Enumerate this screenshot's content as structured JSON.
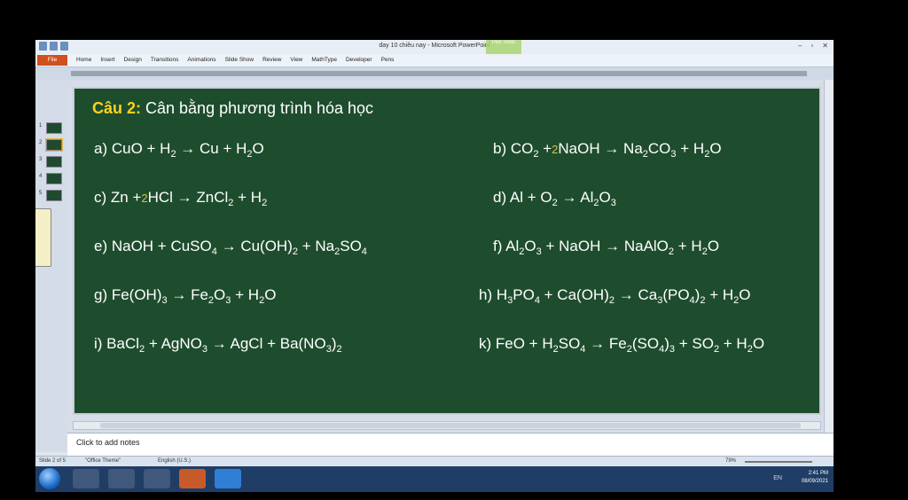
{
  "window": {
    "title": "day 10 chiều nay - Microsoft PowerPoint",
    "context_tab": "Pen Tools"
  },
  "ribbon": {
    "file_label": "File",
    "tabs": [
      "Home",
      "Insert",
      "Design",
      "Transitions",
      "Animations",
      "Slide Show",
      "Review",
      "View",
      "MathType",
      "Developer",
      "Pens"
    ]
  },
  "thumbnails": [
    {
      "num": "1"
    },
    {
      "num": "2"
    },
    {
      "num": "3"
    },
    {
      "num": "4"
    },
    {
      "num": "5"
    }
  ],
  "slide": {
    "question_label": "Câu 2:",
    "question_text": " Cân bằng phương trình hóa học",
    "equations": [
      {
        "id": "a",
        "tokens": [
          "a)  CuO  + H",
          {
            "s": "2"
          },
          " → Cu  + H",
          {
            "s": "2"
          },
          "O"
        ]
      },
      {
        "id": "b",
        "tokens": [
          "b) CO",
          {
            "s": "2"
          },
          " +",
          {
            "ink": "2"
          },
          "NaOH  → Na",
          {
            "s": "2"
          },
          "CO",
          {
            "s": "3"
          },
          " + H",
          {
            "s": "2"
          },
          "O"
        ]
      },
      {
        "id": "c",
        "tokens": [
          "c)  Zn  +",
          {
            "ink": "2"
          },
          "HCl → ZnCl",
          {
            "s": "2"
          },
          "  +  H",
          {
            "s": "2"
          }
        ]
      },
      {
        "id": "d",
        "tokens": [
          "d) Al   +  O",
          {
            "s": "2"
          },
          "  →   Al",
          {
            "s": "2"
          },
          "O",
          {
            "s": "3"
          }
        ]
      },
      {
        "id": "e",
        "tokens": [
          "e)  NaOH  +  CuSO",
          {
            "s": "4"
          },
          " →  Cu(OH)",
          {
            "s": "2"
          },
          "  +  Na",
          {
            "s": "2"
          },
          "SO",
          {
            "s": "4"
          }
        ]
      },
      {
        "id": "f",
        "tokens": [
          "f) Al",
          {
            "s": "2"
          },
          "O",
          {
            "s": "3"
          },
          "  + NaOH    → NaAlO",
          {
            "s": "2"
          },
          " +   H",
          {
            "s": "2"
          },
          "O"
        ]
      },
      {
        "id": "g",
        "tokens": [
          "g)  Fe(OH)",
          {
            "s": "3"
          },
          " → Fe",
          {
            "s": "2"
          },
          "O",
          {
            "s": "3"
          },
          "  +  H",
          {
            "s": "2"
          },
          "O"
        ]
      },
      {
        "id": "h",
        "tokens": [
          "h) H",
          {
            "s": "3"
          },
          "PO",
          {
            "s": "4"
          },
          " +  Ca(OH)",
          {
            "s": "2"
          },
          "  →  Ca",
          {
            "s": "3"
          },
          "(PO",
          {
            "s": "4"
          },
          ")",
          {
            "s": "2"
          },
          " + H",
          {
            "s": "2"
          },
          "O"
        ]
      },
      {
        "id": "i",
        "tokens": [
          "i)  BaCl",
          {
            "s": "2"
          },
          " + AgNO",
          {
            "s": "3"
          },
          "  →  AgCl +  Ba(NO",
          {
            "s": "3"
          },
          ")",
          {
            "s": "2"
          }
        ]
      },
      {
        "id": "k",
        "tokens": [
          "k)  FeO + H",
          {
            "s": "2"
          },
          "SO",
          {
            "s": "4"
          },
          " → Fe",
          {
            "s": "2"
          },
          "(SO",
          {
            "s": "4"
          },
          ")",
          {
            "s": "3"
          },
          " + SO",
          {
            "s": "2"
          },
          " + H",
          {
            "s": "2"
          },
          "O"
        ]
      }
    ]
  },
  "notes": {
    "placeholder": "Click to add notes"
  },
  "status": {
    "slide": "Slide 2 of 5",
    "theme": "\"Office Theme\"",
    "language": "English (U.S.)",
    "zoom": "79%"
  },
  "tray": {
    "time": "2:41 PM",
    "date": "08/09/2021",
    "lang": "EN"
  },
  "colors": {
    "slide_bg": "#1e4d2e",
    "title_label": "#ffd21a",
    "ink": "#d8c24a"
  }
}
